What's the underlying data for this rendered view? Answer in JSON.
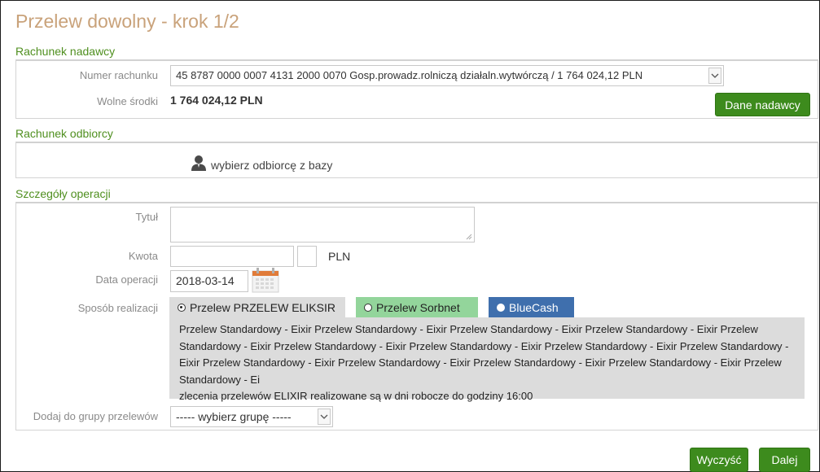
{
  "page": {
    "title": "Przelew dowolny - krok 1/2"
  },
  "sender": {
    "section_title": "Rachunek nadawcy",
    "account_label": "Numer rachunku",
    "account_value": "45 8787 0000 0007 4131 2000 0070 Gosp.prowadz.rolniczą działaln.wytwórczą / 1 764 024,12 PLN",
    "funds_label": "Wolne środki",
    "funds_value": "1 764 024,12 PLN",
    "details_button": "Dane nadawcy"
  },
  "recipient": {
    "section_title": "Rachunek odbiorcy",
    "choose_link": "wybierz odbiorcę z bazy",
    "icon": "user-icon"
  },
  "operation": {
    "section_title": "Szczegóły operacji",
    "title_label": "Tytuł",
    "title_value": "",
    "amount_label": "Kwota",
    "amount_value": "",
    "amount_cents": "",
    "currency": "PLN",
    "date_label": "Data operacji",
    "date_value": "2018-03-14",
    "method_label": "Sposób realizacji",
    "methods": [
      {
        "label": "Przelew PRZELEW ELIKSIR",
        "selected": true,
        "color": "#dcdcdc"
      },
      {
        "label": "Przelew Sorbnet",
        "selected": false,
        "color": "#93d59b"
      },
      {
        "label": "BlueCash",
        "selected": false,
        "color": "#3f6fad"
      }
    ],
    "method_description": "Przelew Standardowy - Eixir Przelew Standardowy - Eixir Przelew Standardowy - Eixir Przelew Standardowy - Eixir Przelew Standardowy - Eixir Przelew Standardowy - Eixir Przelew Standardowy - Eixir Przelew Standardowy - Eixir Przelew Standardowy - Eixir Przelew Standardowy - Eixir Przelew Standardowy - Eixir Przelew Standardowy - Eixir Przelew Standardowy - Eixir Przelew Standardowy - Ei",
    "method_note": "zlecenia przelewów ELIXIR realizowane są w dni robocze do godziny 16:00",
    "group_label": "Dodaj do grupy przelewów",
    "group_value": "----- wybierz grupę -----"
  },
  "actions": {
    "clear": "Wyczyść",
    "next": "Dalej"
  },
  "colors": {
    "accent_green": "#3d8b1d",
    "title_tan": "#c9a27a",
    "section_green": "#4f8f1f"
  }
}
